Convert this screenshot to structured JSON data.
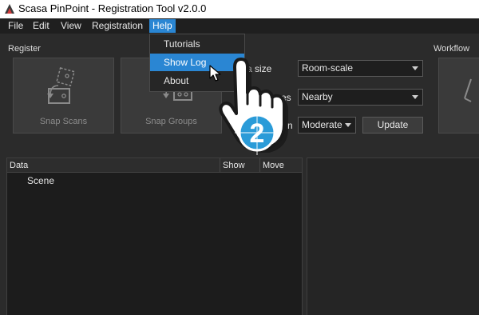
{
  "window": {
    "title": "Scasa PinPoint - Registration Tool v2.0.0"
  },
  "menubar": {
    "file": "File",
    "edit": "Edit",
    "view": "View",
    "registration": "Registration",
    "help": "Help"
  },
  "help_menu": {
    "items": [
      "Tutorials",
      "Show Log",
      "About"
    ],
    "highlighted": "Show Log"
  },
  "register": {
    "label": "Register",
    "snap_scans": "Snap Scans",
    "snap_groups": "Snap Groups"
  },
  "settings": {
    "area_size_label_visible": "a size",
    "area_size_value": "Room-scale",
    "neighbors_label_visible": "es",
    "neighbors_value": "Nearby",
    "closeness_label_visible_left": "Cl",
    "closeness_label_visible_right": "n",
    "closeness_value": "Moderate",
    "update_label": "Update"
  },
  "workflow": {
    "label": "Workflow"
  },
  "tree": {
    "headers": {
      "data": "Data",
      "show": "Show",
      "move": "Move"
    },
    "rows": [
      "Scene"
    ]
  },
  "overlay": {
    "step_number": "2"
  },
  "colors": {
    "accent": "#2a86d3",
    "step_badge": "#2a9bd8"
  }
}
